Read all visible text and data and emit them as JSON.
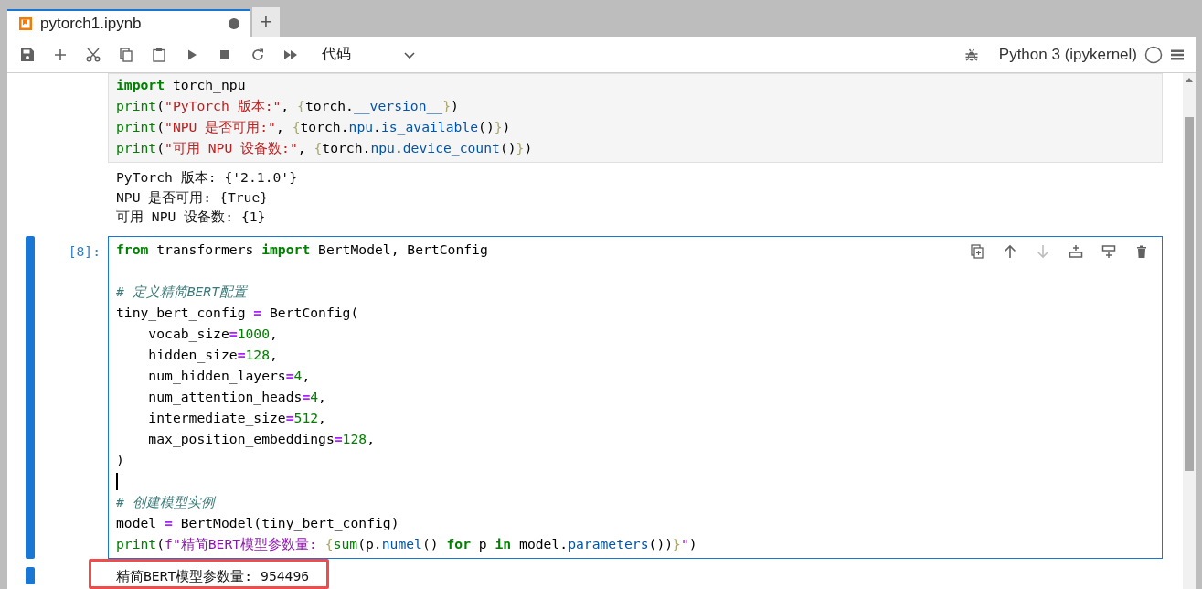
{
  "tab": {
    "title": "pytorch1.ipynb",
    "modified": true,
    "selected": true
  },
  "new_tab_button": "+",
  "toolbar": {
    "cell_type": "代码",
    "kernel": "Python 3 (ipykernel)",
    "kernel_busy": false
  },
  "cells": [
    {
      "active": false,
      "lines": [
        {
          "kind": "code",
          "tokens": [
            {
              "kind": "kw",
              "text": "import"
            },
            {
              "kind": "plain",
              "text": " torch_npu"
            }
          ]
        },
        {
          "kind": "code",
          "tokens": [
            {
              "kind": "builtin",
              "text": "print"
            },
            {
              "kind": "plain",
              "text": "("
            },
            {
              "kind": "str",
              "text": "\"PyTorch 版本:\""
            },
            {
              "kind": "plain",
              "text": ", "
            },
            {
              "kind": "brace",
              "text": "{"
            },
            {
              "kind": "plain",
              "text": "torch."
            },
            {
              "kind": "attr",
              "text": "__version__"
            },
            {
              "kind": "brace",
              "text": "}"
            },
            {
              "kind": "plain",
              "text": ")"
            }
          ]
        },
        {
          "kind": "code",
          "tokens": [
            {
              "kind": "builtin",
              "text": "print"
            },
            {
              "kind": "plain",
              "text": "("
            },
            {
              "kind": "str",
              "text": "\"NPU 是否可用:\""
            },
            {
              "kind": "plain",
              "text": ", "
            },
            {
              "kind": "brace",
              "text": "{"
            },
            {
              "kind": "plain",
              "text": "torch."
            },
            {
              "kind": "attr",
              "text": "npu"
            },
            {
              "kind": "plain",
              "text": "."
            },
            {
              "kind": "attr",
              "text": "is_available"
            },
            {
              "kind": "plain",
              "text": "()"
            },
            {
              "kind": "brace",
              "text": "}"
            },
            {
              "kind": "plain",
              "text": ")"
            }
          ]
        },
        {
          "kind": "code",
          "tokens": [
            {
              "kind": "builtin",
              "text": "print"
            },
            {
              "kind": "plain",
              "text": "("
            },
            {
              "kind": "str",
              "text": "\"可用 NPU 设备数:\""
            },
            {
              "kind": "plain",
              "text": ", "
            },
            {
              "kind": "brace",
              "text": "{"
            },
            {
              "kind": "plain",
              "text": "torch."
            },
            {
              "kind": "attr",
              "text": "npu"
            },
            {
              "kind": "plain",
              "text": "."
            },
            {
              "kind": "attr",
              "text": "device_count"
            },
            {
              "kind": "plain",
              "text": "()"
            },
            {
              "kind": "brace",
              "text": "}"
            },
            {
              "kind": "plain",
              "text": ")"
            }
          ]
        }
      ],
      "output": [
        "PyTorch 版本: {'2.1.0'}",
        "NPU 是否可用: {True}",
        "可用 NPU 设备数: {1}"
      ],
      "output_highlighted": false
    },
    {
      "active": true,
      "prompt": "[8]:",
      "cell_tools": [
        {
          "kind": "duplicate",
          "disabled": false
        },
        {
          "kind": "move-up",
          "disabled": false
        },
        {
          "kind": "move-down",
          "disabled": true
        },
        {
          "kind": "insert-above",
          "disabled": false
        },
        {
          "kind": "insert-below",
          "disabled": false
        },
        {
          "kind": "delete",
          "disabled": false
        }
      ],
      "lines": [
        {
          "kind": "code",
          "tokens": [
            {
              "kind": "kw",
              "text": "from"
            },
            {
              "kind": "plain",
              "text": " transformers "
            },
            {
              "kind": "kw",
              "text": "import"
            },
            {
              "kind": "plain",
              "text": " BertModel, BertConfig"
            }
          ]
        },
        {
          "kind": "blank"
        },
        {
          "kind": "code",
          "tokens": [
            {
              "kind": "cmt",
              "text": "# 定义精简BERT配置"
            }
          ]
        },
        {
          "kind": "code",
          "tokens": [
            {
              "kind": "plain",
              "text": "tiny_bert_config "
            },
            {
              "kind": "op",
              "text": "="
            },
            {
              "kind": "plain",
              "text": " BertConfig("
            }
          ]
        },
        {
          "kind": "code",
          "tokens": [
            {
              "kind": "plain",
              "text": "    vocab_size"
            },
            {
              "kind": "op",
              "text": "="
            },
            {
              "kind": "num",
              "text": "1000"
            },
            {
              "kind": "plain",
              "text": ","
            }
          ]
        },
        {
          "kind": "code",
          "tokens": [
            {
              "kind": "plain",
              "text": "    hidden_size"
            },
            {
              "kind": "op",
              "text": "="
            },
            {
              "kind": "num",
              "text": "128"
            },
            {
              "kind": "plain",
              "text": ","
            }
          ]
        },
        {
          "kind": "code",
          "tokens": [
            {
              "kind": "plain",
              "text": "    num_hidden_layers"
            },
            {
              "kind": "op",
              "text": "="
            },
            {
              "kind": "num",
              "text": "4"
            },
            {
              "kind": "plain",
              "text": ","
            }
          ]
        },
        {
          "kind": "code",
          "tokens": [
            {
              "kind": "plain",
              "text": "    num_attention_heads"
            },
            {
              "kind": "op",
              "text": "="
            },
            {
              "kind": "num",
              "text": "4"
            },
            {
              "kind": "plain",
              "text": ","
            }
          ]
        },
        {
          "kind": "code",
          "tokens": [
            {
              "kind": "plain",
              "text": "    intermediate_size"
            },
            {
              "kind": "op",
              "text": "="
            },
            {
              "kind": "num",
              "text": "512"
            },
            {
              "kind": "plain",
              "text": ","
            }
          ]
        },
        {
          "kind": "code",
          "tokens": [
            {
              "kind": "plain",
              "text": "    max_position_embeddings"
            },
            {
              "kind": "op",
              "text": "="
            },
            {
              "kind": "num",
              "text": "128"
            },
            {
              "kind": "plain",
              "text": ","
            }
          ]
        },
        {
          "kind": "code",
          "tokens": [
            {
              "kind": "plain",
              "text": ")"
            }
          ]
        },
        {
          "kind": "cursor"
        },
        {
          "kind": "code",
          "tokens": [
            {
              "kind": "cmt",
              "text": "# 创建模型实例"
            }
          ]
        },
        {
          "kind": "code",
          "tokens": [
            {
              "kind": "plain",
              "text": "model "
            },
            {
              "kind": "op",
              "text": "="
            },
            {
              "kind": "plain",
              "text": " BertModel(tiny_bert_config)"
            }
          ]
        },
        {
          "kind": "code",
          "tokens": [
            {
              "kind": "builtin",
              "text": "print"
            },
            {
              "kind": "plain",
              "text": "("
            },
            {
              "kind": "fstr",
              "text": "f\"精简BERT模型参数量: "
            },
            {
              "kind": "brace",
              "text": "{"
            },
            {
              "kind": "builtin",
              "text": "sum"
            },
            {
              "kind": "plain",
              "text": "(p."
            },
            {
              "kind": "attr",
              "text": "numel"
            },
            {
              "kind": "plain",
              "text": "() "
            },
            {
              "kind": "kw",
              "text": "for"
            },
            {
              "kind": "plain",
              "text": " p "
            },
            {
              "kind": "kw",
              "text": "in"
            },
            {
              "kind": "plain",
              "text": " model."
            },
            {
              "kind": "attr",
              "text": "parameters"
            },
            {
              "kind": "plain",
              "text": "())"
            },
            {
              "kind": "brace",
              "text": "}"
            },
            {
              "kind": "fstr",
              "text": "\""
            },
            {
              "kind": "plain",
              "text": ")"
            }
          ]
        }
      ],
      "output": [
        "精简BERT模型参数量: 954496"
      ],
      "output_highlighted": true
    }
  ]
}
